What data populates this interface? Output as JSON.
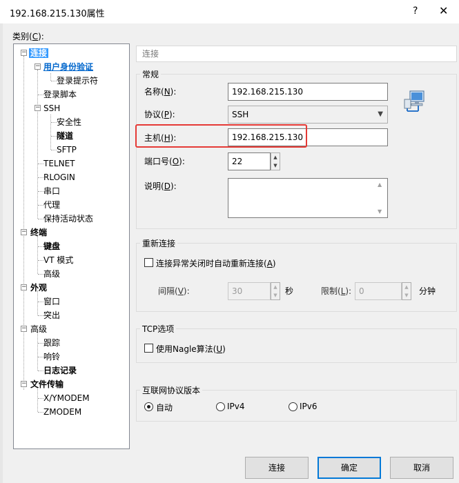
{
  "window": {
    "title": "192.168.215.130属性",
    "help": "?",
    "close": "✕"
  },
  "category_label": {
    "text": "类别(",
    "key": "C",
    "suffix": "):"
  },
  "tree": {
    "connection": "连接",
    "auth": "用户身份验证",
    "login_prompt": "登录提示符",
    "login_script": "登录脚本",
    "ssh": "SSH",
    "security": "安全性",
    "tunnel": "隧道",
    "sftp": "SFTP",
    "telnet": "TELNET",
    "rlogin": "RLOGIN",
    "serial": "串口",
    "proxy": "代理",
    "keepalive": "保持活动状态",
    "terminal": "终端",
    "keyboard": "键盘",
    "vt_mode": "VT 模式",
    "advanced": "高级",
    "appearance": "外观",
    "window": "窗口",
    "highlight": "突出",
    "advanced2": "高级",
    "trace": "跟踪",
    "bell": "响铃",
    "logging": "日志记录",
    "file_transfer": "文件传输",
    "xymodem": "X/YMODEM",
    "zmodem": "ZMODEM"
  },
  "section_title": "连接",
  "general": {
    "title": "常规",
    "name_label": {
      "text": "名称(",
      "key": "N",
      "suffix": "):"
    },
    "name_value": "192.168.215.130",
    "protocol_label": {
      "text": "协议(",
      "key": "P",
      "suffix": "):"
    },
    "protocol_value": "SSH",
    "host_label": {
      "text": "主机(",
      "key": "H",
      "suffix": "):"
    },
    "host_value": "192.168.215.130",
    "port_label": {
      "text": "端口号(",
      "key": "O",
      "suffix": "):"
    },
    "port_value": "22",
    "desc_label": {
      "text": "说明(",
      "key": "D",
      "suffix": "):"
    }
  },
  "reconnect": {
    "title": "重新连接",
    "auto_label": {
      "text": "连接异常关闭时自动重新连接(",
      "key": "A",
      "suffix": ")"
    },
    "interval_label": {
      "text": "间隔(",
      "key": "V",
      "suffix": "):"
    },
    "interval_value": "30",
    "interval_unit": "秒",
    "limit_label": {
      "text": "限制(",
      "key": "L",
      "suffix": "):"
    },
    "limit_value": "0",
    "limit_unit": "分钟"
  },
  "tcp": {
    "title": "TCP选项",
    "nagle_label": {
      "text": "使用Nagle算法(",
      "key": "U",
      "suffix": ")"
    }
  },
  "ipver": {
    "title": "互联网协议版本",
    "options": [
      "自动",
      "IPv4",
      "IPv6"
    ],
    "selected": "自动"
  },
  "buttons": {
    "connect": "连接",
    "ok": "确定",
    "cancel": "取消"
  },
  "colors": {
    "accent": "#0078d7",
    "selection": "#3399ff",
    "highlight_box": "#e53935"
  },
  "icons": {
    "computer": "network-computer-icon"
  }
}
